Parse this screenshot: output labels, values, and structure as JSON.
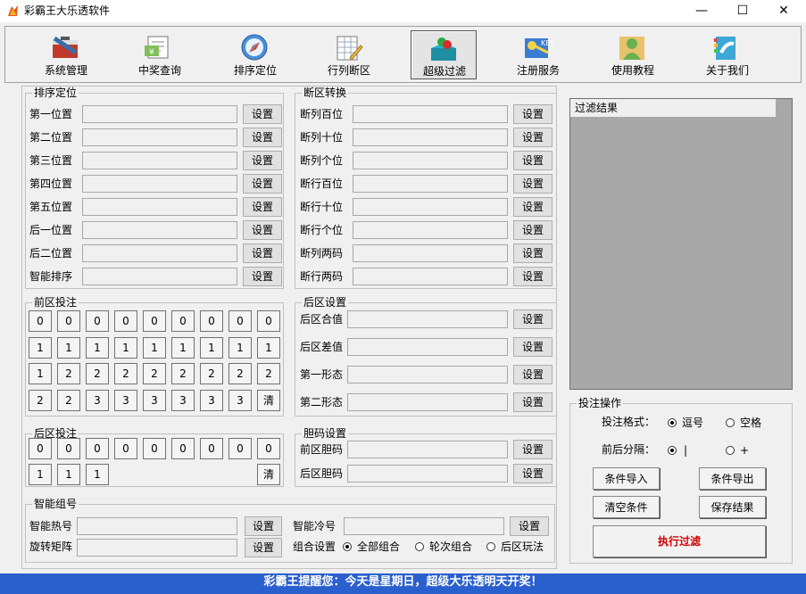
{
  "window": {
    "title": "彩霸王大乐透软件",
    "minimize": "—",
    "maximize": "☐",
    "close": "✕"
  },
  "toolbar": [
    {
      "label": "系统管理",
      "icon": "toolbox-icon",
      "active": false
    },
    {
      "label": "中奖查询",
      "icon": "money-document-icon",
      "active": false
    },
    {
      "label": "排序定位",
      "icon": "compass-icon",
      "active": false
    },
    {
      "label": "行列断区",
      "icon": "spreadsheet-pencil-icon",
      "active": false
    },
    {
      "label": "超级过滤",
      "icon": "filter-box-icon",
      "active": true
    },
    {
      "label": "注册服务",
      "icon": "keys-icon",
      "active": false
    },
    {
      "label": "使用教程",
      "icon": "user-help-icon",
      "active": false
    },
    {
      "label": "关于我们",
      "icon": "phone-book-icon",
      "active": false
    }
  ],
  "sort_group": {
    "title": "排序定位",
    "rows": [
      "第一位置",
      "第二位置",
      "第三位置",
      "第四位置",
      "第五位置",
      "后一位置",
      "后二位置",
      "智能排序"
    ],
    "button": "设置"
  },
  "break_group": {
    "title": "断区转换",
    "rows": [
      "断列百位",
      "断列十位",
      "断列个位",
      "断行百位",
      "断行十位",
      "断行个位",
      "断列两码",
      "断行两码"
    ],
    "button": "设置"
  },
  "front_group": {
    "title": "前区投注",
    "grid": [
      [
        "0",
        "0",
        "0",
        "0",
        "0",
        "0",
        "0",
        "0",
        "0"
      ],
      [
        "1",
        "1",
        "1",
        "1",
        "1",
        "1",
        "1",
        "1",
        "1"
      ],
      [
        "1",
        "2",
        "2",
        "2",
        "2",
        "2",
        "2",
        "2",
        "2"
      ],
      [
        "2",
        "2",
        "3",
        "3",
        "3",
        "3",
        "3",
        "3",
        "清"
      ]
    ]
  },
  "back_setting": {
    "title": "后区设置",
    "rows": [
      "后区合值",
      "后区差值",
      "第一形态",
      "第二形态"
    ],
    "button": "设置"
  },
  "back_group": {
    "title": "后区投注",
    "row1": [
      "0",
      "0",
      "0",
      "0",
      "0",
      "0",
      "0",
      "0",
      "0"
    ],
    "row2": [
      "1",
      "1",
      "1"
    ],
    "clear": "清"
  },
  "dan_group": {
    "title": "胆码设置",
    "rows": [
      "前区胆码",
      "后区胆码"
    ],
    "button": "设置"
  },
  "smart_group": {
    "title": "智能组号",
    "hot": "智能热号",
    "cold": "智能冷号",
    "rotate": "旋转矩阵",
    "combo": "组合设置",
    "button": "设置",
    "options": [
      "全部组合",
      "轮次组合",
      "后区玩法"
    ],
    "selected": 0
  },
  "result": {
    "header": "过滤结果"
  },
  "operation": {
    "title": "投注操作",
    "format_label": "投注格式：",
    "format_options": [
      "逗号",
      "空格"
    ],
    "separator_label": "前后分隔：",
    "separator_options": [
      "|",
      "+"
    ],
    "import": "条件导入",
    "export": "条件导出",
    "clear": "清空条件",
    "save": "保存结果",
    "run": "执行过滤"
  },
  "status": {
    "text": "彩霸王提醒您：今天是星期日，超级大乐透明天开奖！"
  }
}
